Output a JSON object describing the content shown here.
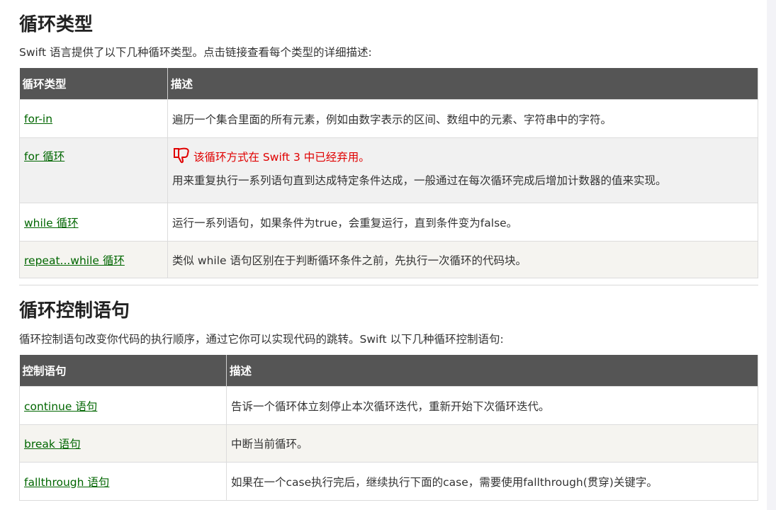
{
  "section1": {
    "title": "循环类型",
    "intro": "Swift 语言提供了以下几种循环类型。点击链接查看每个类型的详细描述:",
    "headers": [
      "循环类型",
      "描述"
    ],
    "rows": [
      {
        "name": "for-in",
        "desc": "遍历一个集合里面的所有元素，例如由数字表示的区间、数组中的元素、字符串中的字符。"
      },
      {
        "name": "for 循环",
        "warning": "该循环方式在 Swift 3 中已经弃用。",
        "desc": "用来重复执行一系列语句直到达成特定条件达成，一般通过在每次循环完成后增加计数器的值来实现。"
      },
      {
        "name": "while 循环",
        "desc": "运行一系列语句，如果条件为true，会重复运行，直到条件变为false。"
      },
      {
        "name": "repeat...while 循环",
        "desc": "类似 while 语句区别在于判断循环条件之前，先执行一次循环的代码块。"
      }
    ]
  },
  "section2": {
    "title": "循环控制语句",
    "intro": "循环控制语句改变你代码的执行顺序，通过它你可以实现代码的跳转。Swift 以下几种循环控制语句:",
    "headers": [
      "控制语句",
      "描述"
    ],
    "rows": [
      {
        "name": "continue 语句",
        "desc": "告诉一个循环体立刻停止本次循环迭代，重新开始下次循环迭代。"
      },
      {
        "name": "break 语句",
        "desc": "中断当前循环。"
      },
      {
        "name": "fallthrough 语句",
        "desc": "如果在一个case执行完后，继续执行下面的case，需要使用fallthrough(贯穿)关键字。"
      }
    ]
  },
  "icons": {
    "warning_icon": "thumbs-down-icon"
  },
  "colors": {
    "link": "#006600",
    "warning": "#e00000",
    "header_bg": "#555555"
  }
}
